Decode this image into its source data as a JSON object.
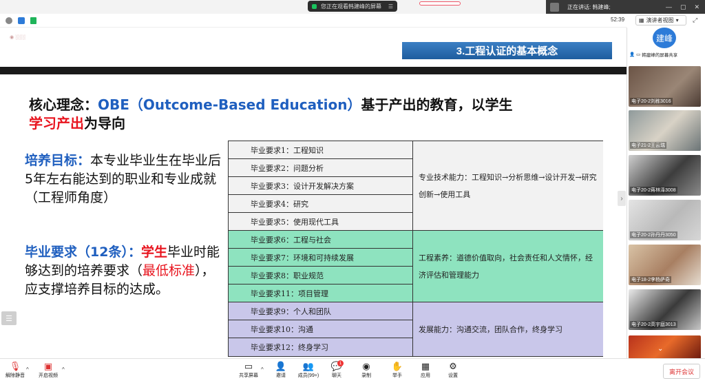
{
  "topbar": {
    "share_notice": "您正在观看韩建峰的屏幕",
    "speaking": "正在讲话: 韩建峰;"
  },
  "subbar": {
    "timer": "52:39",
    "view_label": "演讲者视图"
  },
  "slide": {
    "section_title": "3.工程认证的基本概念",
    "core": {
      "lead": "核心理念：",
      "obe": "OBE（Outcome-Based Education）",
      "tail": "基于产出的教育，以学生",
      "red": "学习产出",
      "end": "为导向"
    },
    "goal": {
      "label": "培养目标：",
      "text": "本专业毕业生在毕业后5年左右能达到的职业和专业成就（工程师角度）"
    },
    "req": {
      "label": "毕业要求（12条）：",
      "red": "学生",
      "text1": "毕业时能够达到的培养要求（",
      "red2": "最低标准",
      "text2": "），应支撑培养目标的达成。"
    },
    "table": {
      "rows": [
        "毕业要求1：工程知识",
        "毕业要求2：问题分析",
        "毕业要求3：设计开发解决方案",
        "毕业要求4：研究",
        "毕业要求5：使用现代工具",
        "毕业要求6：工程与社会",
        "毕业要求7：环境和可持续发展",
        "毕业要求8：职业规范",
        "毕业要求11：项目管理",
        "毕业要求9：个人和团队",
        "毕业要求10：沟通",
        "毕业要求12：终身学习"
      ],
      "groups": [
        "专业技术能力：工程知识→分析思维→设计开发→研究创新→使用工具",
        "工程素养：道德价值取向，社会责任和人文情怀，经济评估和管理能力",
        "发展能力：沟通交流，团队合作，终身学习"
      ]
    }
  },
  "panel": {
    "host_avatar": "建峰",
    "host_caption": "韩建峰的屏幕共享",
    "tiles": [
      "电子20-2刘栋3016",
      "电子21-2王云瑞",
      "电子20-2蒋林泽3008",
      "电子20-2孙丹丹3050",
      "电子18-2李杨萨奇",
      "电子20-2高宇庭3013"
    ]
  },
  "toolbar": {
    "mute": "解除静音",
    "video": "开启视频",
    "share": "共享屏幕",
    "invite": "邀请",
    "members": "成员(99+)",
    "chat": "聊天",
    "record": "录制",
    "hand": "举手",
    "apps": "应用",
    "settings": "设置",
    "leave": "离开会议",
    "chat_badge": "1"
  },
  "colors": {
    "accent_blue": "#1f5fbf",
    "accent_red": "#e8141e",
    "group2_green": "#8ee3bf",
    "group3_purple": "#c9c7ea"
  }
}
